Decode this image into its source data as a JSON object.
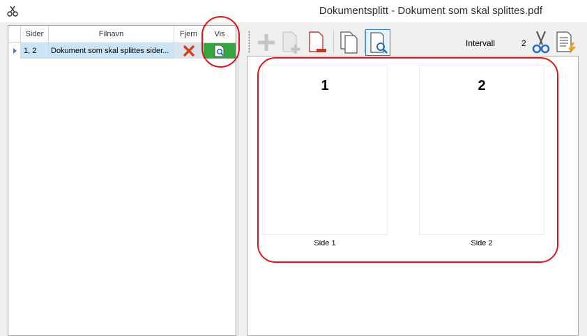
{
  "window": {
    "title": "Dokumentsplitt - Dokument som skal splittes.pdf"
  },
  "grid": {
    "columns": {
      "sider": "Sider",
      "filnavn": "Filnavn",
      "fjern": "Fjern",
      "vis": "Vis"
    },
    "rows": [
      {
        "sider": "1, 2",
        "filnavn": "Dokument som skal splittes sider..."
      }
    ]
  },
  "toolbar": {
    "intervall_label": "Intervall",
    "intervall_value": "2"
  },
  "preview": {
    "pages": [
      {
        "number": "1",
        "caption": "Side 1"
      },
      {
        "number": "2",
        "caption": "Side 2"
      }
    ]
  },
  "colors": {
    "annotation": "#e0141b",
    "selection": "#cce4f7",
    "vis_cell": "#34a53f"
  }
}
